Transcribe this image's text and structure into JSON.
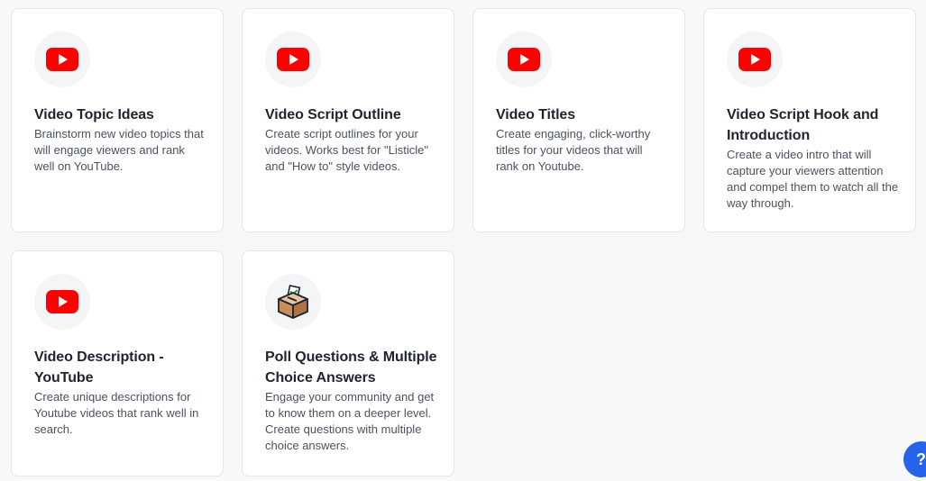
{
  "cards": [
    {
      "title": "Video Topic Ideas",
      "description": "Brainstorm new video topics that will engage viewers and rank well on YouTube.",
      "icon": "youtube-play-icon"
    },
    {
      "title": "Video Script Outline",
      "description": "Create script outlines for your videos. Works best for \"Listicle\" and \"How to\" style videos.",
      "icon": "youtube-play-icon"
    },
    {
      "title": "Video Titles",
      "description": "Create engaging, click-worthy titles for your videos that will rank on Youtube.",
      "icon": "youtube-play-icon"
    },
    {
      "title": "Video Script Hook and Introduction",
      "description": "Create a video intro that will capture your viewers attention and compel them to watch all the way through.",
      "icon": "youtube-play-icon"
    },
    {
      "title": "Video Description - YouTube",
      "description": "Create unique descriptions for Youtube videos that rank well in search.",
      "icon": "youtube-play-icon"
    },
    {
      "title": "Poll Questions & Multiple Choice Answers",
      "description": "Engage your community and get to know them on a deeper level. Create questions with multiple choice answers.",
      "icon": "ballot-box-icon"
    }
  ],
  "help": {
    "label": "?"
  },
  "colors": {
    "youtube_red": "#ff0000",
    "help_blue": "#2563eb",
    "title_text": "#1f2430",
    "desc_text": "#4b5260"
  }
}
